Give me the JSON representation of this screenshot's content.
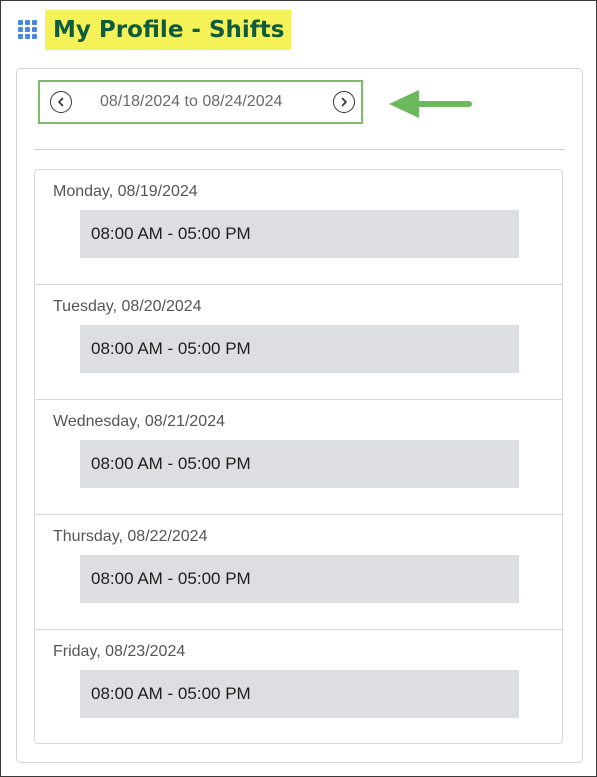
{
  "header": {
    "title": "My Profile - Shifts",
    "icon": "grid-icon"
  },
  "nav": {
    "range": "08/18/2024 to 08/24/2024",
    "prev_icon": "chevron-left-icon",
    "next_icon": "chevron-right-icon"
  },
  "colors": {
    "title_highlight": "#f5f258",
    "title_text": "#0f5b3e",
    "nav_border": "#7dbb6a",
    "arrow": "#6cb85c",
    "shift_bg": "#dddee1"
  },
  "days": [
    {
      "label": "Monday, 08/19/2024",
      "shift": "08:00 AM - 05:00 PM"
    },
    {
      "label": "Tuesday, 08/20/2024",
      "shift": "08:00 AM - 05:00 PM"
    },
    {
      "label": "Wednesday, 08/21/2024",
      "shift": "08:00 AM - 05:00 PM"
    },
    {
      "label": "Thursday, 08/22/2024",
      "shift": "08:00 AM - 05:00 PM"
    },
    {
      "label": "Friday, 08/23/2024",
      "shift": "08:00 AM - 05:00 PM"
    }
  ]
}
